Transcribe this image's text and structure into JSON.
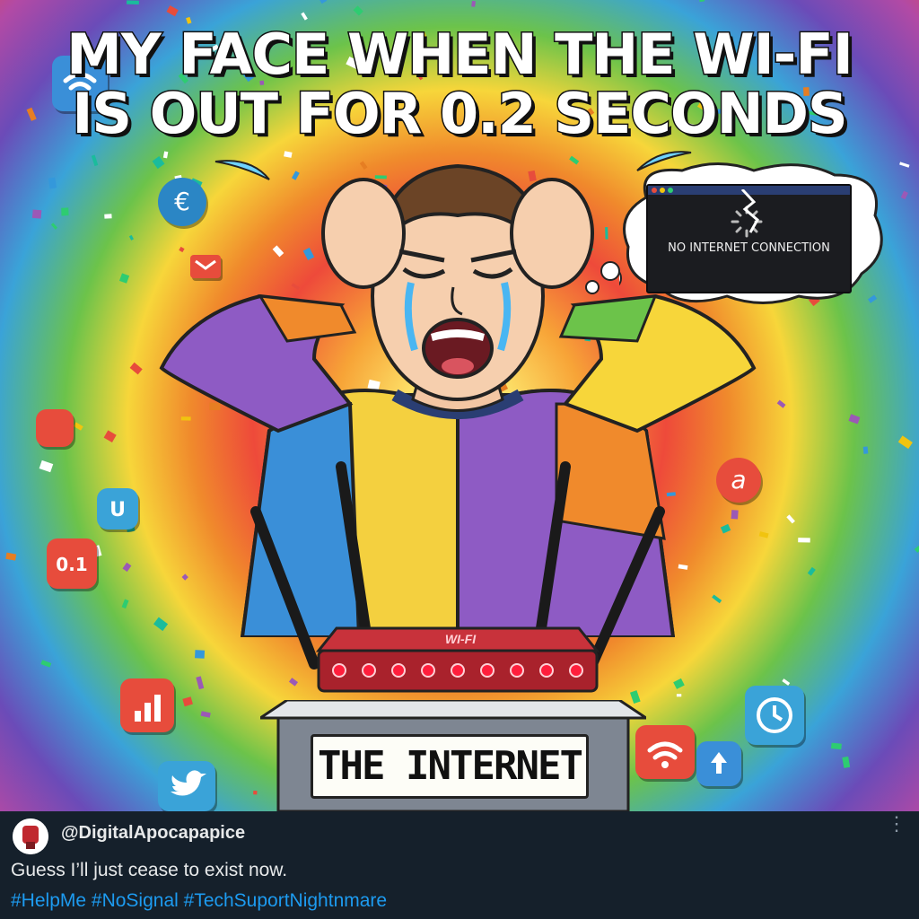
{
  "meme": {
    "title_line1": "MY FACE WHEN THE WI-FI",
    "title_line2": "IS OUT FOR 0.2 SECONDS",
    "thought_bubble": {
      "screen_message": "NO INTERNET CONNECTION"
    },
    "router": {
      "label": "WI-FI",
      "led_color": "#ff1e3c",
      "led_count": 9
    },
    "pedestal_sign": "THE INTERNET",
    "floating_icons": [
      "wifi-icon",
      "euro-icon",
      "mail-icon",
      "cable-icon",
      "signal-bars-icon",
      "at-sign-icon",
      "twitter-bird-icon",
      "clock-icon",
      "usb-plug-icon"
    ]
  },
  "post": {
    "handle": "@DigitalApocapapice",
    "text": "Guess I’ll just cease to exist now.",
    "hashtags": [
      "#HelpMe",
      "#NoSignal",
      "#TechSuportNightnmare"
    ]
  },
  "colors": {
    "post_background": "#15202b",
    "post_text": "#e7e9ea",
    "hashtag": "#1d9bf0",
    "more_icon": "#8b98a5"
  }
}
